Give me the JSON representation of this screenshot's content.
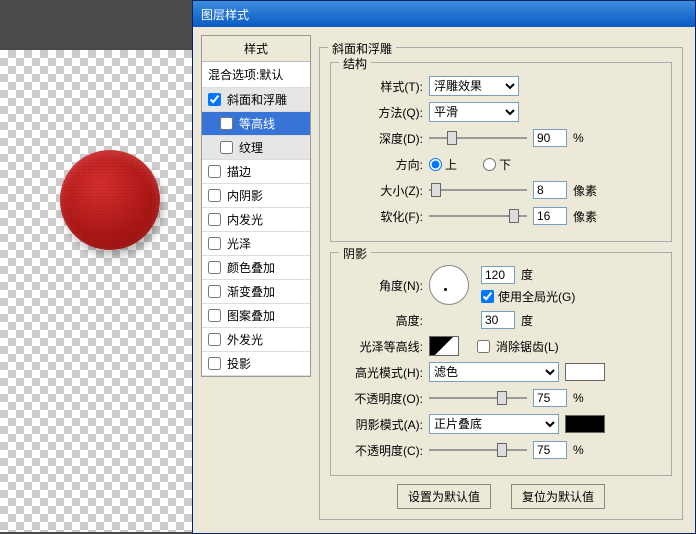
{
  "dialog": {
    "title": "图层样式"
  },
  "styles_panel": {
    "header": "样式",
    "blend_options": "混合选项:默认",
    "items": [
      {
        "label": "斜面和浮雕",
        "checked": true,
        "sel": "parent"
      },
      {
        "label": "等高线",
        "checked": false,
        "sel": "child_selected"
      },
      {
        "label": "纹理",
        "checked": false,
        "sel": "child"
      },
      {
        "label": "描边",
        "checked": false
      },
      {
        "label": "内阴影",
        "checked": false
      },
      {
        "label": "内发光",
        "checked": false
      },
      {
        "label": "光泽",
        "checked": false
      },
      {
        "label": "颜色叠加",
        "checked": false
      },
      {
        "label": "渐变叠加",
        "checked": false
      },
      {
        "label": "图案叠加",
        "checked": false
      },
      {
        "label": "外发光",
        "checked": false
      },
      {
        "label": "投影",
        "checked": false
      }
    ]
  },
  "bevel": {
    "section_title": "斜面和浮雕",
    "structure_title": "结构",
    "style_label": "样式(T):",
    "style_value": "浮雕效果",
    "method_label": "方法(Q):",
    "method_value": "平滑",
    "depth_label": "深度(D):",
    "depth_value": "90",
    "depth_unit": "%",
    "direction_label": "方向:",
    "dir_up": "上",
    "dir_down": "下",
    "size_label": "大小(Z):",
    "size_value": "8",
    "size_unit": "像素",
    "soften_label": "软化(F):",
    "soften_value": "16",
    "soften_unit": "像素"
  },
  "shading": {
    "title": "阴影",
    "angle_label": "角度(N):",
    "angle_value": "120",
    "angle_unit": "度",
    "global_light": "使用全局光(G)",
    "altitude_label": "高度:",
    "altitude_value": "30",
    "altitude_unit": "度",
    "gloss_label": "光泽等高线:",
    "antialias": "消除锯齿(L)",
    "hl_mode_label": "高光模式(H):",
    "hl_mode_value": "滤色",
    "hl_color": "#ffffff",
    "hl_opacity_label": "不透明度(O):",
    "hl_opacity_value": "75",
    "hl_opacity_unit": "%",
    "sh_mode_label": "阴影模式(A):",
    "sh_mode_value": "正片叠底",
    "sh_color": "#000000",
    "sh_opacity_label": "不透明度(C):",
    "sh_opacity_value": "75",
    "sh_opacity_unit": "%"
  },
  "buttons": {
    "default": "设置为默认值",
    "reset": "复位为默认值"
  }
}
